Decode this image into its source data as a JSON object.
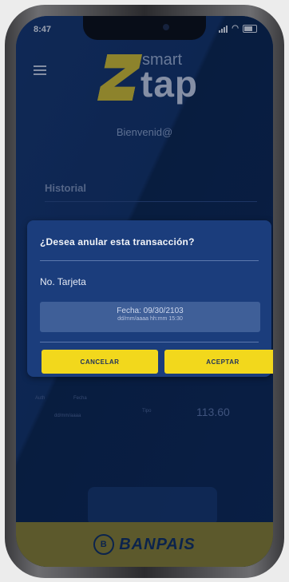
{
  "status_bar": {
    "time": "8:47"
  },
  "header": {
    "logo_small": "smart",
    "logo_large": "tap"
  },
  "welcome_text": "Bienvenid@",
  "history": {
    "title": "Historial",
    "labels": [
      "Auth",
      "Fecha",
      "Tipo"
    ],
    "date": "dd/mm/aaaa",
    "amount": "113.60"
  },
  "footer": {
    "brand": "BANPAIS",
    "coin": "B"
  },
  "dialog": {
    "title": "¿Desea anular esta transacción?",
    "card_label": "No. Tarjeta",
    "date_line": "Fecha: 09/30/2103",
    "date_sub": "dd/mm/aaaa   hh:mm   15:30",
    "cancel_label": "CANCELAR",
    "accept_label": "ACEPTAR"
  },
  "colors": {
    "background": "#0e2c5b",
    "dialog": "#1b3d7c",
    "accent_yellow": "#f2d81c",
    "footer": "#8a7f2a"
  }
}
